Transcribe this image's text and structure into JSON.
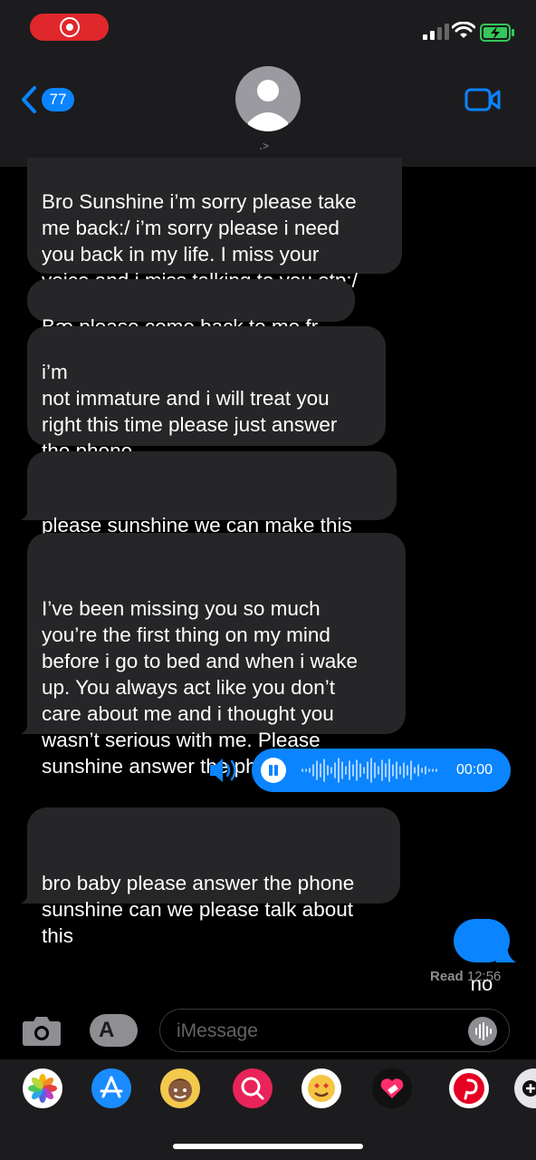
{
  "nav": {
    "back_count": "77",
    "contact_name": ".",
    "chevron": ">"
  },
  "messages": [
    {
      "text": "Bro Sunshine i’m sorry please take\nme back:/ i’m sorry please i need\nyou back in my life. I miss your\nvoice and i miss talking to you otp:/"
    },
    {
      "text": "Bæ please come back to me fr"
    },
    {
      "text": "i’m\nnot immature and i will treat you\nright this time please just answer\nthe phone"
    },
    {
      "text": "please sunshine we can make this\nwork this time i promise"
    },
    {
      "text": "I’ve been missing you so much\nyou’re the first thing on my mind\nbefore i go to bed and when i wake\nup. You always act like you don’t\ncare about me and i thought you\nwasn’t serious with me. Please\nsunshine answer the phone broooo"
    },
    {
      "text": "bro baby please answer the phone\nsunshine can we please talk about\nthis"
    }
  ],
  "audio_message": {
    "duration": "00:00"
  },
  "outgoing": {
    "text": "no"
  },
  "receipt": {
    "label": "Read",
    "time": "12:56"
  },
  "composer": {
    "placeholder": "iMessage"
  },
  "colors": {
    "incoming": "#262628",
    "outgoing": "#0a84ff",
    "bar": "#1c1c1e",
    "recording": "#e0272b"
  },
  "app_drawer": [
    "photos-icon",
    "app-store-icon",
    "memoji-icon",
    "web-search-icon",
    "animoji-icon",
    "heart-sticker-icon",
    "pinterest-icon",
    "more-apps-icon"
  ]
}
